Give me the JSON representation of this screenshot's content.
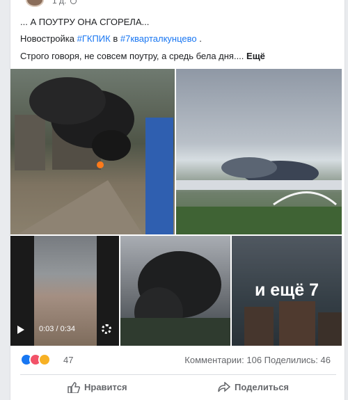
{
  "post": {
    "time": "1 д.",
    "line1": "... А ПОУТРУ ОНА СГОРЕЛА...",
    "line2_prefix": "Новостройка ",
    "tag1": "#ГКПИК",
    "line2_mid": " в ",
    "tag2": "#7кварталкунцево",
    "line2_suffix": " .",
    "line3": "Строго говоря, не совсем поутру, а средь бела дня.... ",
    "more": "Ещё"
  },
  "media": {
    "video_time": "0:03 / 0:34",
    "more_photos": "и ещё 7"
  },
  "footer": {
    "reactions_count": "47",
    "stats": "Комментарии: 106  Поделились: 46",
    "like_label": "Нравится",
    "share_label": "Поделиться"
  },
  "colors": {
    "accent": "#1876f2",
    "secondary_text": "#65676b"
  },
  "icons": [
    "like-reaction-icon",
    "angry-reaction-icon",
    "wow-reaction-icon",
    "play-icon",
    "gear-icon",
    "like-icon",
    "share-icon"
  ]
}
